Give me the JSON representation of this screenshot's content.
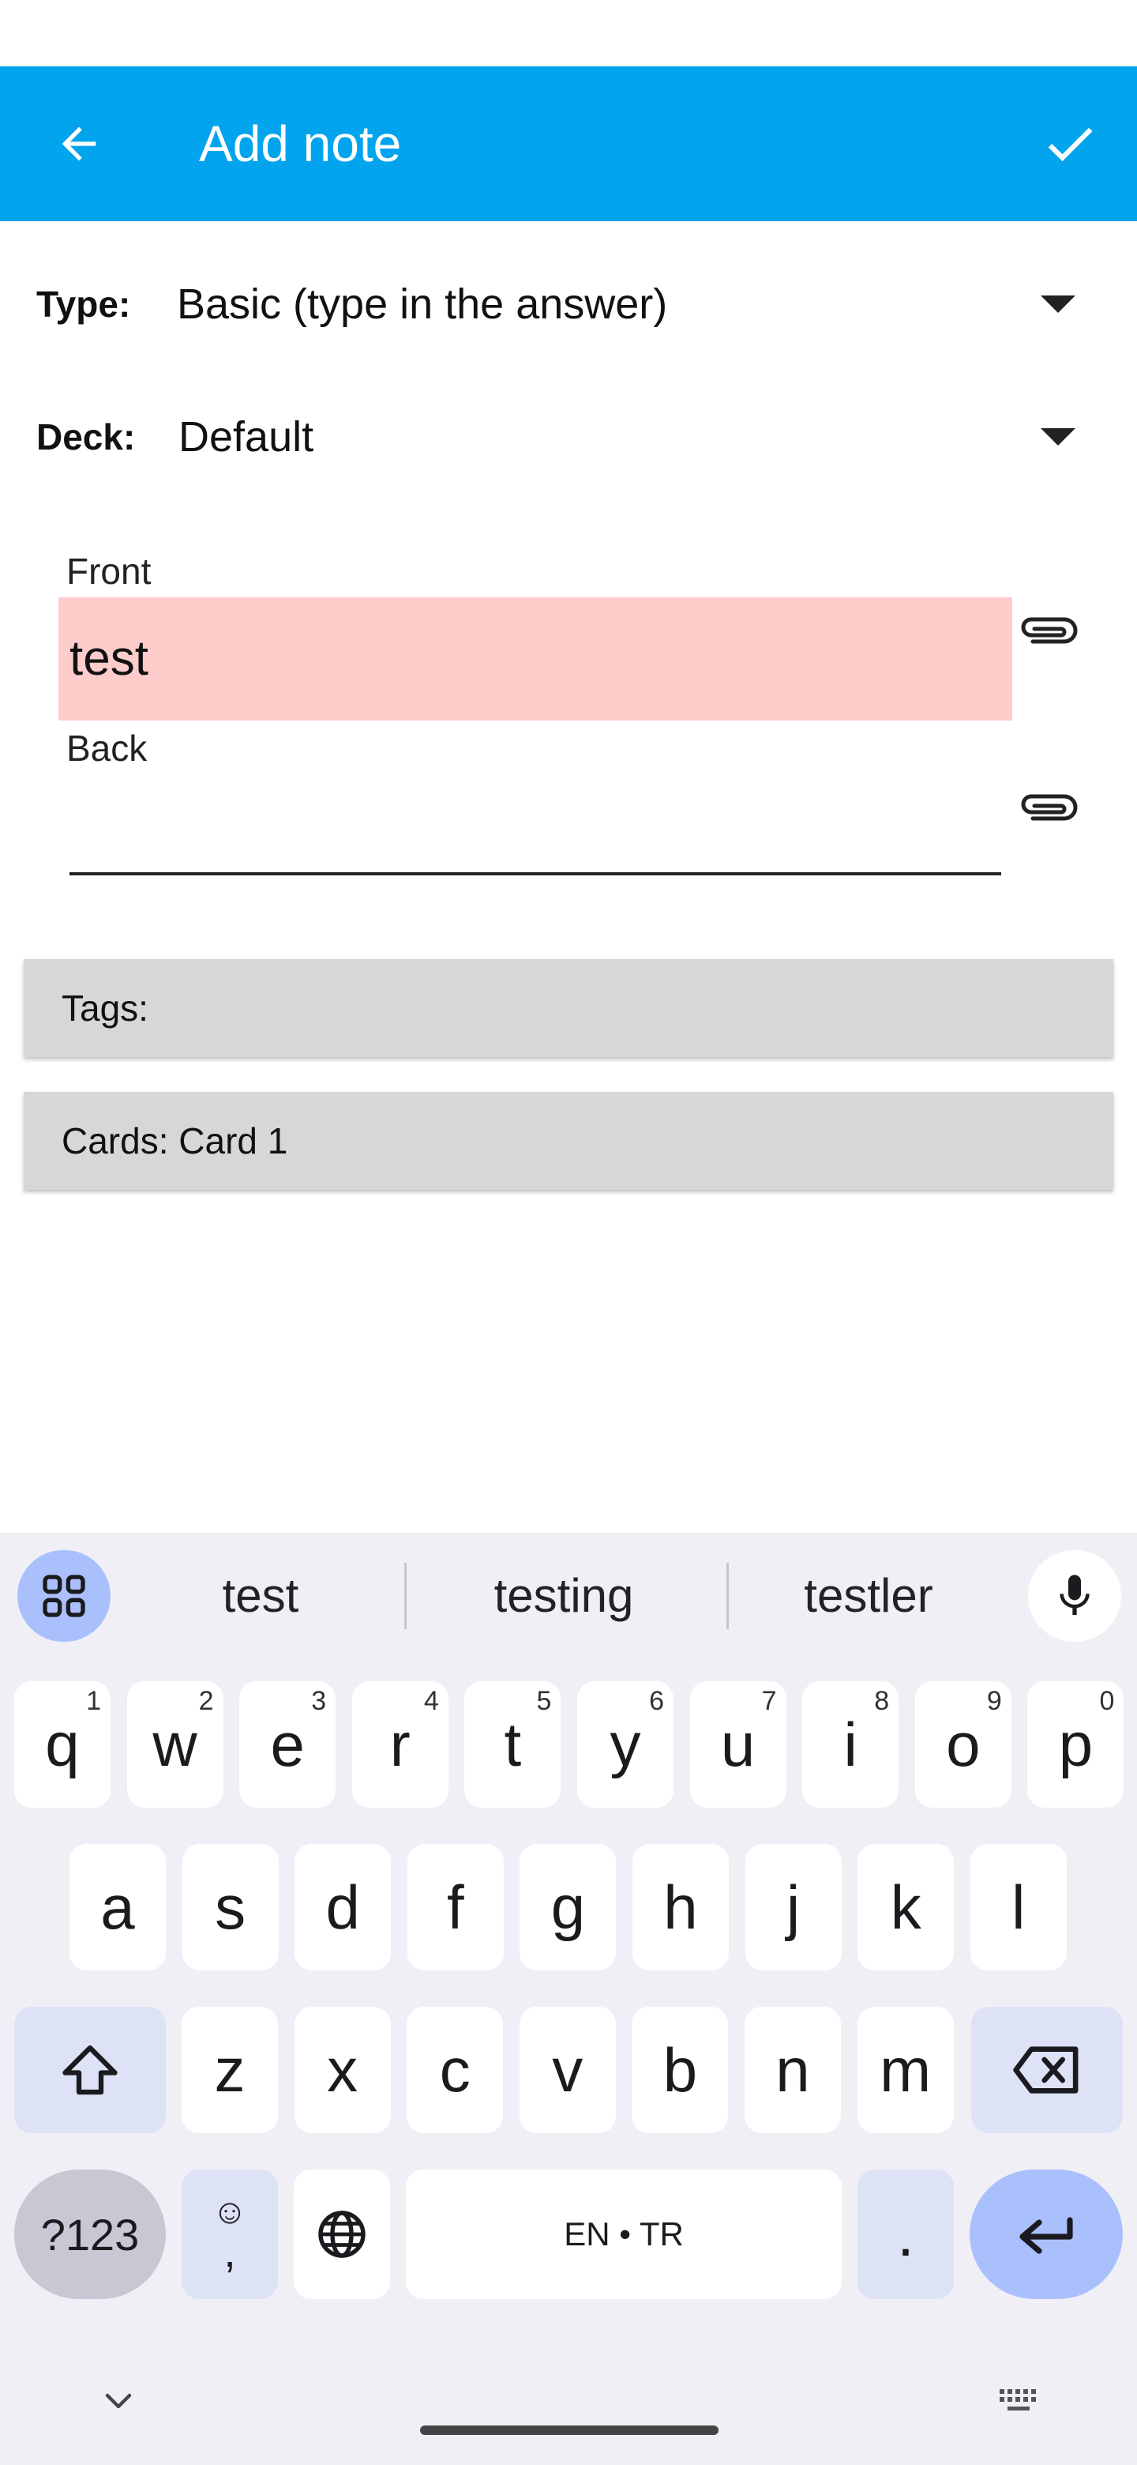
{
  "appbar": {
    "title": "Add note",
    "color": "#03a4ee"
  },
  "form": {
    "type_label": "Type:",
    "type_value": "Basic (type in the answer)",
    "deck_label": "Deck:",
    "deck_value": "Default",
    "front_label": "Front",
    "front_value": "test",
    "front_highlight": "#ffcccc",
    "back_label": "Back",
    "back_value": "",
    "tags_label": "Tags:",
    "cards_label": "Cards: Card 1"
  },
  "keyboard": {
    "suggestions": [
      "test",
      "testing",
      "testler"
    ],
    "row1": [
      {
        "k": "q",
        "h": "1"
      },
      {
        "k": "w",
        "h": "2"
      },
      {
        "k": "e",
        "h": "3"
      },
      {
        "k": "r",
        "h": "4"
      },
      {
        "k": "t",
        "h": "5"
      },
      {
        "k": "y",
        "h": "6"
      },
      {
        "k": "u",
        "h": "7"
      },
      {
        "k": "i",
        "h": "8"
      },
      {
        "k": "o",
        "h": "9"
      },
      {
        "k": "p",
        "h": "0"
      }
    ],
    "row2": [
      "a",
      "s",
      "d",
      "f",
      "g",
      "h",
      "j",
      "k",
      "l"
    ],
    "row3": [
      "z",
      "x",
      "c",
      "v",
      "b",
      "n",
      "m"
    ],
    "symbols_label": "?123",
    "emoji_top": "☺",
    "emoji_bottom": ",",
    "space_label": "EN • TR",
    "period_label": ".",
    "accent": "#aac0fc"
  }
}
